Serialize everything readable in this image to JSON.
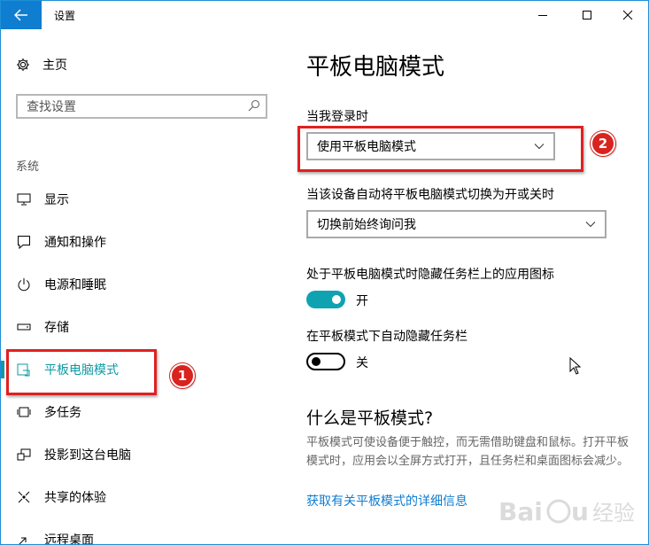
{
  "window": {
    "title": "设置"
  },
  "sidebar": {
    "home_label": "主页",
    "search_placeholder": "查找设置",
    "section_label": "系统",
    "items": [
      {
        "label": "显示",
        "icon": "monitor-icon"
      },
      {
        "label": "通知和操作",
        "icon": "notification-icon"
      },
      {
        "label": "电源和睡眠",
        "icon": "power-icon"
      },
      {
        "label": "存储",
        "icon": "storage-icon"
      },
      {
        "label": "平板电脑模式",
        "icon": "tablet-mode-icon",
        "active": true
      },
      {
        "label": "多任务",
        "icon": "multitasking-icon"
      },
      {
        "label": "投影到这台电脑",
        "icon": "project-icon"
      },
      {
        "label": "共享的体验",
        "icon": "shared-experience-icon"
      },
      {
        "label": "远程桌面",
        "icon": "remote-desktop-icon"
      }
    ]
  },
  "main": {
    "title": "平板电脑模式",
    "signin_label": "当我登录时",
    "signin_value": "使用平板电脑模式",
    "switch_label": "当该设备自动将平板电脑模式切换为开或关时",
    "switch_value": "切换前始终询问我",
    "hide_icons_label": "处于平板电脑模式时隐藏任务栏上的应用图标",
    "hide_icons_state": "开",
    "hide_taskbar_label": "在平板模式下自动隐藏任务栏",
    "hide_taskbar_state": "关",
    "what_title": "什么是平板模式?",
    "what_desc": "平板模式可使设备便于触控，而无需借助键盘和鼠标。打开平板模式时，应用会以全屏方式打开，且任务栏和桌面图标会减少。",
    "link_text": "获取有关平板模式的详细信息"
  },
  "annotations": {
    "badge1": "1",
    "badge2": "2"
  },
  "watermark": {
    "text": "Baidu 经验"
  },
  "colors": {
    "accent": "#0f9aa5",
    "titlebar_back": "#0f7dd0",
    "annotation_red": "#e02020"
  }
}
